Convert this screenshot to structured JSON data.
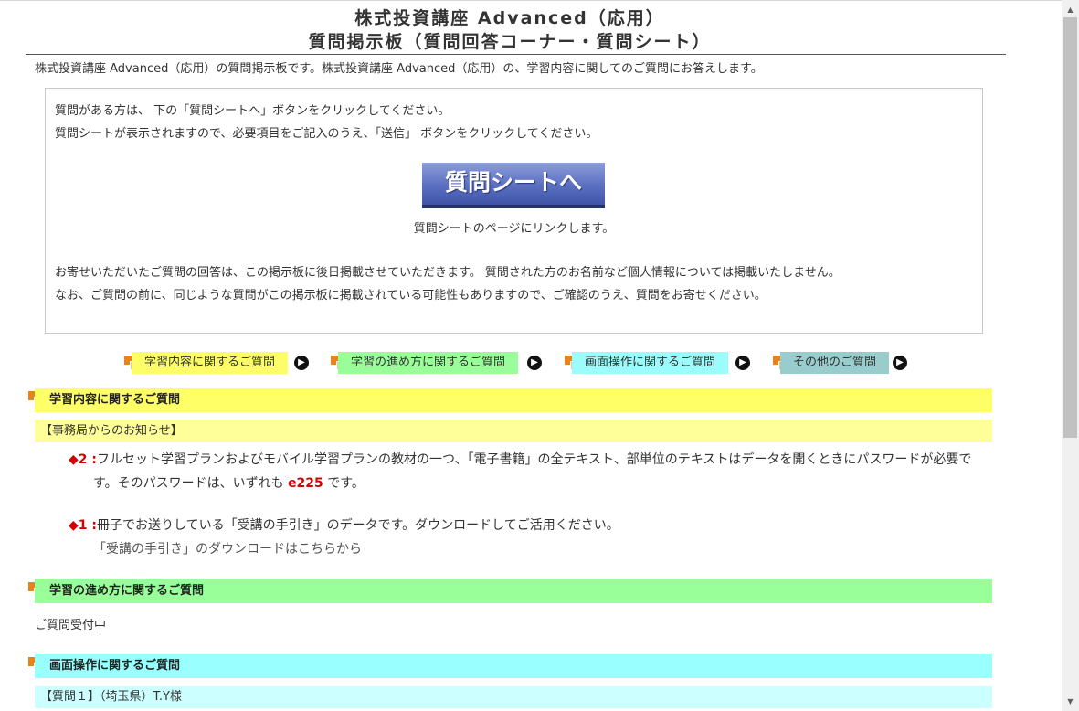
{
  "header": {
    "title_line1": "株式投資講座 Advanced（応用）",
    "title_line2": "質問掲示板（質問回答コーナー・質問シート）",
    "intro": "株式投資講座 Advanced（応用）の質問掲示板です。株式投資講座 Advanced（応用）の、学習内容に関してのご質問にお答えします。"
  },
  "info_box": {
    "line1": "質問がある方は、 下の「質問シートへ」ボタンをクリックしてください。",
    "line2": "質問シートが表示されますので、必要項目をご記入のうえ、「送信」 ボタンをクリックしてください。",
    "button_label": "質問シートへ",
    "button_caption": "質問シートのページにリンクします。",
    "line3": "お寄せいただいたご質問の回答は、この掲示板に後日掲載させていただきます。 質問された方のお名前など個人情報については掲載いたしません。",
    "line4": "なお、ご質問の前に、同じような質問がこの掲示板に掲載されている可能性もありますので、ご確認のうえ、質問をお寄せください。"
  },
  "nav": [
    {
      "label": "学習内容に関するご質問",
      "color": "#fdfd6a"
    },
    {
      "label": "学習の進め方に関するご質問",
      "color": "#99fe99"
    },
    {
      "label": "画面操作に関するご質問",
      "color": "#9cfcfc"
    },
    {
      "label": "その他のご質問",
      "color": "#99cccc"
    }
  ],
  "sections": {
    "learning": {
      "title": "学習内容に関するご質問",
      "color": "#ffff66",
      "sub_title": "【事務局からのお知らせ】",
      "sub_color": "#ffff99",
      "notice2_num": "2 :",
      "notice2_text_a": "フルセット学習プランおよびモバイル学習プランの教材の一つ、「電子書籍」の全テキスト、部単位のテキストはデータを開くときにパスワードが必要で",
      "notice2_text_b": "す。そのパスワードは、いずれも",
      "notice2_password": "e225",
      "notice2_text_c": "です。",
      "notice1_num": "1 :",
      "notice1_text": "冊子でお送りしている「受講の手引き」のデータです。ダウンロードしてご活用ください。",
      "notice1_link": "「受講の手引き」のダウンロードはこちらから"
    },
    "progress": {
      "title": "学習の進め方に関するご質問",
      "color": "#99ff99",
      "status": "ご質問受付中"
    },
    "screen": {
      "title": "画面操作に関するご質問",
      "color": "#99ffff",
      "q1_label": "【質問１】（埼玉県）T.Y様",
      "q1_color": "#ccffff"
    }
  },
  "icons": {
    "diamond": "◆",
    "arrow": "▶",
    "scroll_up": "▲",
    "scroll_down": "▼"
  }
}
